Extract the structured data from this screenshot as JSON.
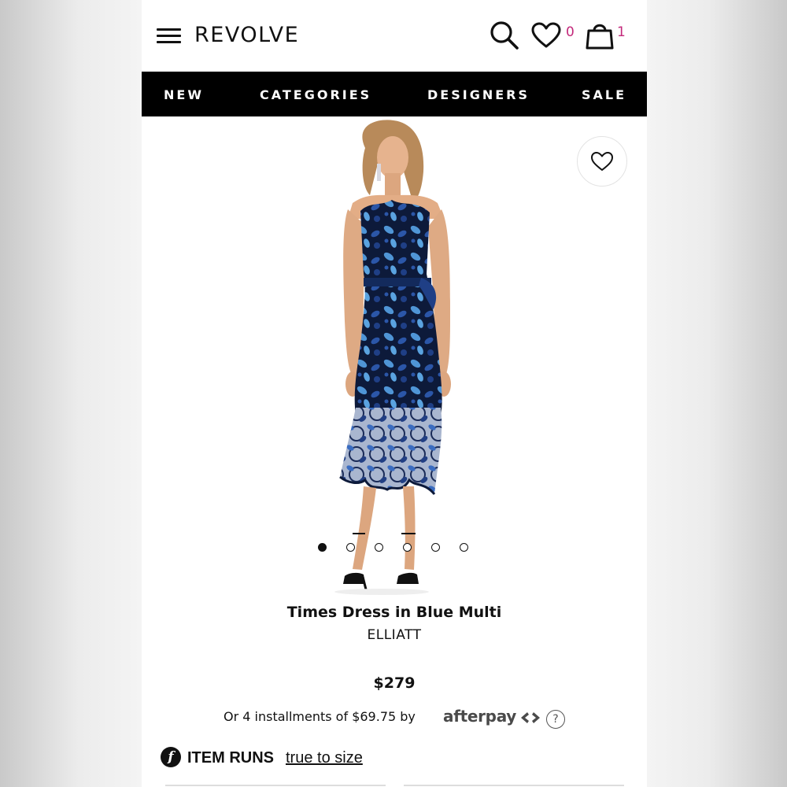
{
  "header": {
    "logo_text": "REVOLVE",
    "wishlist_count": "0",
    "bag_count": "1"
  },
  "nav": {
    "items": [
      {
        "label": "NEW"
      },
      {
        "label": "CATEGORIES"
      },
      {
        "label": "DESIGNERS"
      },
      {
        "label": "SALE"
      }
    ]
  },
  "gallery": {
    "image_count": 6,
    "active_index": 0
  },
  "product": {
    "title": "Times Dress in Blue Multi",
    "designer": "ELLIATT",
    "price": "$279"
  },
  "afterpay": {
    "text": "Or 4 installments of $69.75 by",
    "brand": "afterpay",
    "help_symbol": "?"
  },
  "fit": {
    "icon_letter": "f",
    "label": "ITEM RUNS",
    "value": "true to size"
  },
  "colors": {
    "accent_badge": "#c3297b",
    "nav_bg": "#000000",
    "dress_dark": "#0d1a3a",
    "dress_mid": "#2b56a8",
    "dress_light": "#4f95d6"
  },
  "icons": [
    "menu-icon",
    "search-icon",
    "heart-icon",
    "shopping-bag-icon",
    "question-icon"
  ]
}
